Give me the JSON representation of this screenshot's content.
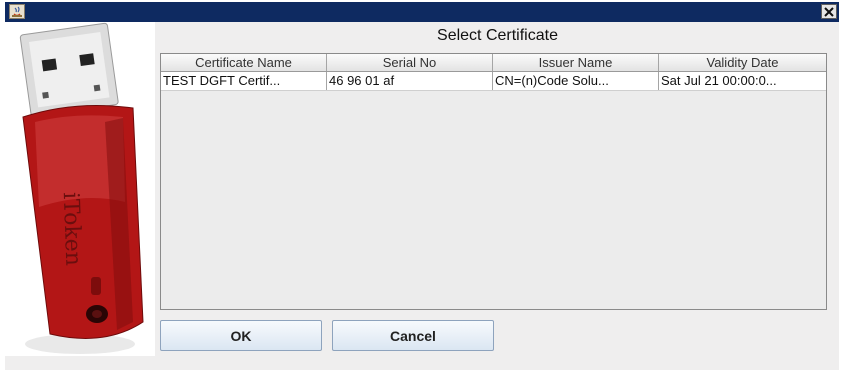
{
  "window": {
    "title_icon": "java-icon",
    "close_icon": "close-icon"
  },
  "dialog": {
    "title": "Select Certificate"
  },
  "table": {
    "columns": [
      "Certificate Name",
      "Serial No",
      "Issuer Name",
      "Validity Date"
    ],
    "rows": [
      [
        "TEST DGFT Certif...",
        "46 96 01 af",
        "CN=(n)Code Solu...",
        "Sat Jul 21 00:00:0..."
      ]
    ]
  },
  "buttons": {
    "ok_label": "OK",
    "cancel_label": "Cancel"
  },
  "token": {
    "brand_text": "iToken"
  },
  "colors": {
    "titlebar": "#0e2a61",
    "content_bg": "#efeeee",
    "token_red": "#b31616",
    "button_border": "#8ea3bd"
  }
}
